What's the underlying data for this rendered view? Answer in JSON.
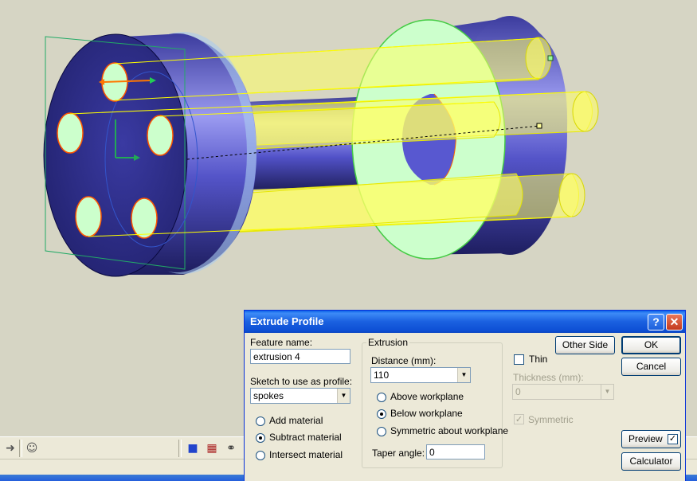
{
  "dialog": {
    "title": "Extrude Profile",
    "help_label": "?",
    "close_label": "✕",
    "feature_name_label": "Feature name:",
    "feature_name_value": "extrusion 4",
    "sketch_label": "Sketch to use as profile:",
    "sketch_value": "spokes",
    "operations": [
      {
        "label": "Add material",
        "selected": false
      },
      {
        "label": "Subtract material",
        "selected": true
      },
      {
        "label": "Intersect material",
        "selected": false
      }
    ],
    "extrusion_group_label": "Extrusion",
    "distance_label": "Distance (mm):",
    "distance_value": "110",
    "directions": [
      {
        "label": "Above workplane",
        "selected": false
      },
      {
        "label": "Below workplane",
        "selected": true
      },
      {
        "label": "Symmetric about workplane",
        "selected": false
      }
    ],
    "taper_label": "Taper angle:",
    "taper_value": "0",
    "other_side_label": "Other Side",
    "thin_label": "Thin",
    "thin_checked": false,
    "thickness_label": "Thickness (mm):",
    "thickness_value": "0",
    "symmetric_label": "Symmetric",
    "symmetric_checked": true,
    "ok_label": "OK",
    "cancel_label": "Cancel",
    "preview_label": "Preview",
    "preview_checked": true,
    "calculator_label": "Calculator"
  },
  "toolbar": {
    "icons": [
      "arrow-right-icon",
      "smiley-icon",
      "box-view-icon",
      "extrude-icon",
      "bike-icon"
    ]
  },
  "colors": {
    "viewport_bg": "#d6d5c4",
    "part_body": "#5b5bd6",
    "selected_face": "#ccffcc",
    "extrusion_preview": "#ffff66",
    "titlebar": "#0a5fe8"
  }
}
